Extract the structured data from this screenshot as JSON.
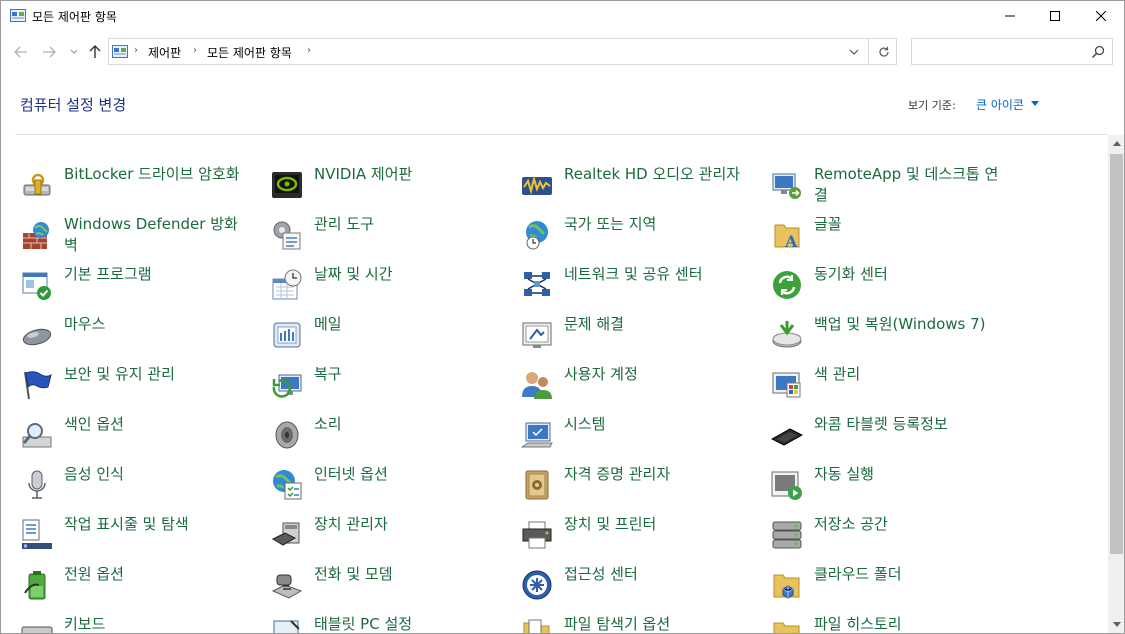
{
  "window": {
    "title": "모든 제어판 항목",
    "controls": {
      "minimize": "minimize",
      "maximize": "maximize",
      "close": "close"
    }
  },
  "address_bar": {
    "breadcrumbs": [
      "제어판",
      "모든 제어판 항목"
    ],
    "search_placeholder": ""
  },
  "header": {
    "title": "컴퓨터 설정 변경",
    "view_by_label": "보기 기준:",
    "view_by_value": "큰 아이콘"
  },
  "items": [
    {
      "label": "BitLocker 드라이브 암호화",
      "icon": "bitlocker-icon"
    },
    {
      "label": "NVIDIA 제어판",
      "icon": "nvidia-icon"
    },
    {
      "label": "Realtek HD 오디오 관리자",
      "icon": "realtek-audio-icon"
    },
    {
      "label": "RemoteApp 및 데스크톱 연결",
      "icon": "remoteapp-icon"
    },
    {
      "label": "Windows Defender 방화벽",
      "icon": "firewall-icon"
    },
    {
      "label": "관리 도구",
      "icon": "admin-tools-icon"
    },
    {
      "label": "국가 또는 지역",
      "icon": "region-icon"
    },
    {
      "label": "글꼴",
      "icon": "fonts-icon"
    },
    {
      "label": "기본 프로그램",
      "icon": "default-programs-icon"
    },
    {
      "label": "날짜 및 시간",
      "icon": "date-time-icon"
    },
    {
      "label": "네트워크 및 공유 센터",
      "icon": "network-icon"
    },
    {
      "label": "동기화 센터",
      "icon": "sync-icon"
    },
    {
      "label": "마우스",
      "icon": "mouse-icon"
    },
    {
      "label": "메일",
      "icon": "mail-icon"
    },
    {
      "label": "문제 해결",
      "icon": "troubleshoot-icon"
    },
    {
      "label": "백업 및 복원(Windows 7)",
      "icon": "backup-icon"
    },
    {
      "label": "보안 및 유지 관리",
      "icon": "security-flag-icon"
    },
    {
      "label": "복구",
      "icon": "recovery-icon"
    },
    {
      "label": "사용자 계정",
      "icon": "user-accounts-icon"
    },
    {
      "label": "색 관리",
      "icon": "color-management-icon"
    },
    {
      "label": "색인 옵션",
      "icon": "indexing-icon"
    },
    {
      "label": "소리",
      "icon": "sound-icon"
    },
    {
      "label": "시스템",
      "icon": "system-icon"
    },
    {
      "label": "와콤 타블렛 등록정보",
      "icon": "wacom-tablet-icon"
    },
    {
      "label": "음성 인식",
      "icon": "microphone-icon"
    },
    {
      "label": "인터넷 옵션",
      "icon": "internet-options-icon"
    },
    {
      "label": "자격 증명 관리자",
      "icon": "credential-manager-icon"
    },
    {
      "label": "자동 실행",
      "icon": "autoplay-icon"
    },
    {
      "label": "작업 표시줄 및 탐색",
      "icon": "taskbar-icon"
    },
    {
      "label": "장치 관리자",
      "icon": "device-manager-icon"
    },
    {
      "label": "장치 및 프린터",
      "icon": "printer-icon"
    },
    {
      "label": "저장소 공간",
      "icon": "storage-spaces-icon"
    },
    {
      "label": "전원 옵션",
      "icon": "power-icon"
    },
    {
      "label": "전화 및 모뎀",
      "icon": "phone-modem-icon"
    },
    {
      "label": "접근성 센터",
      "icon": "ease-of-access-icon"
    },
    {
      "label": "클라우드 폴더",
      "icon": "cloud-folder-icon"
    },
    {
      "label": "키보드",
      "icon": "keyboard-icon"
    },
    {
      "label": "태블릿 PC 설정",
      "icon": "tablet-pc-icon"
    },
    {
      "label": "파일 탐색기 옵션",
      "icon": "explorer-options-icon"
    },
    {
      "label": "파일 히스토리",
      "icon": "file-history-icon"
    }
  ]
}
